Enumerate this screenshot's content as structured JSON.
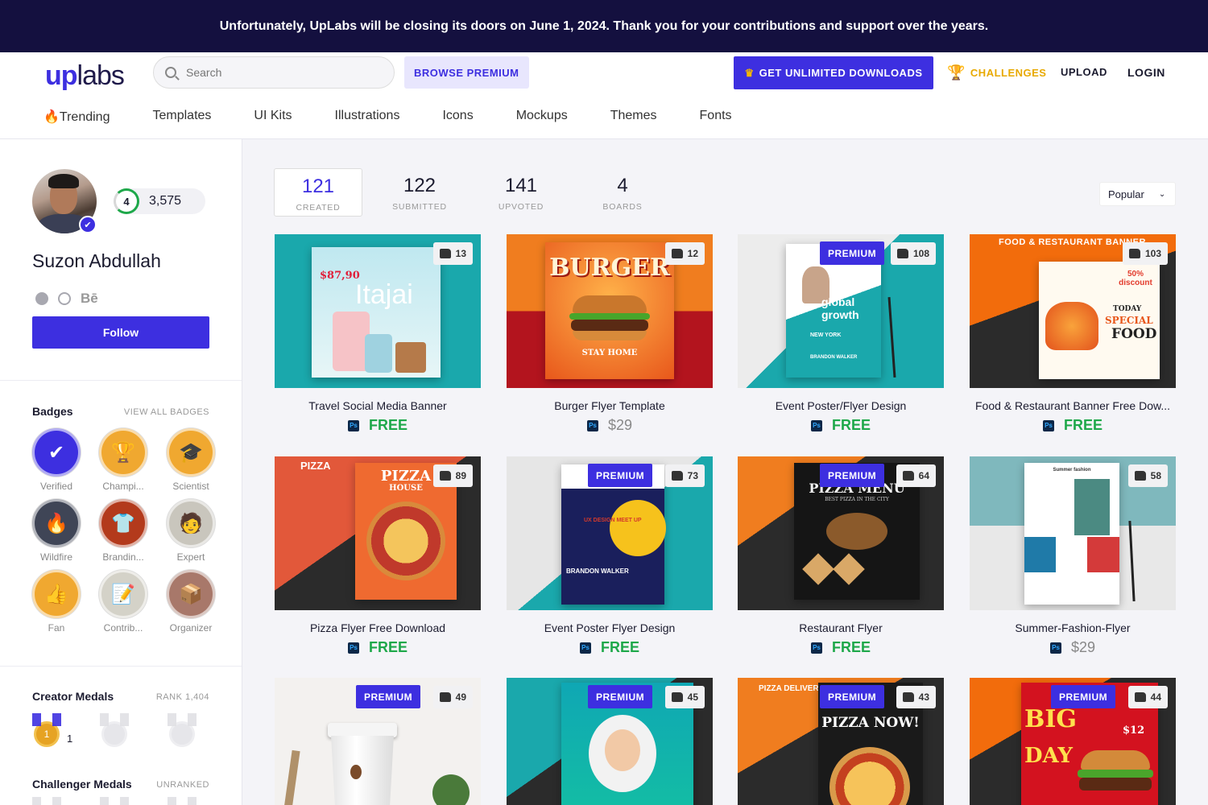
{
  "banner": {
    "text": "Unfortunately, UpLabs will be closing its doors on June 1, 2024. Thank you for your contributions and support over the years."
  },
  "header": {
    "logo_up": "up",
    "logo_labs": "labs",
    "search_placeholder": "Search",
    "browse_premium": "BROWSE PREMIUM",
    "get_unlimited": "GET UNLIMITED DOWNLOADS",
    "challenges": "CHALLENGES",
    "upload": "UPLOAD",
    "login": "LOGIN"
  },
  "nav": {
    "items": [
      "🔥Trending",
      "Templates",
      "UI Kits",
      "Illustrations",
      "Icons",
      "Mockups",
      "Themes",
      "Fonts"
    ]
  },
  "profile": {
    "name": "Suzon Abdullah",
    "level": "4",
    "points": "3,575",
    "behance": "Bē",
    "follow": "Follow"
  },
  "badges": {
    "title": "Badges",
    "view_all": "VIEW ALL BADGES",
    "items": [
      {
        "label": "Verified",
        "icon": "checkmark-icon",
        "color": "#3d2fe0",
        "glyph": "✔"
      },
      {
        "label": "Champi...",
        "icon": "trophy-icon",
        "color": "#f0a830",
        "glyph": "🏆"
      },
      {
        "label": "Scientist",
        "icon": "graduation-cap-icon",
        "color": "#f0a830",
        "glyph": "🎓"
      },
      {
        "label": "Wildfire",
        "icon": "fire-icon",
        "color": "#3f4556",
        "glyph": "🔥"
      },
      {
        "label": "Brandin...",
        "icon": "tshirt-icon",
        "color": "#b33a1c",
        "glyph": "👕"
      },
      {
        "label": "Expert",
        "icon": "expert-icon",
        "color": "#c9c6bd",
        "glyph": "🧑"
      },
      {
        "label": "Fan",
        "icon": "thumbs-up-icon",
        "color": "#f0a830",
        "glyph": "👍"
      },
      {
        "label": "Contrib...",
        "icon": "notepad-icon",
        "color": "#d4d2c8",
        "glyph": "📝"
      },
      {
        "label": "Organizer",
        "icon": "box-icon",
        "color": "#a8786a",
        "glyph": "📦"
      }
    ]
  },
  "creator_medals": {
    "title": "Creator Medals",
    "rank": "RANK 1,404",
    "count": "1",
    "first": "1"
  },
  "challenger_medals": {
    "title": "Challenger Medals",
    "rank": "UNRANKED"
  },
  "stats": [
    {
      "num": "121",
      "label": "CREATED"
    },
    {
      "num": "122",
      "label": "SUBMITTED"
    },
    {
      "num": "141",
      "label": "UPVOTED"
    },
    {
      "num": "4",
      "label": "BOARDS"
    }
  ],
  "sort": {
    "value": "Popular"
  },
  "premium_label": "PREMIUM",
  "ps_label": "Ps",
  "cards": [
    {
      "title": "Travel Social Media Banner",
      "price": "FREE",
      "likes": "13"
    },
    {
      "title": "Burger Flyer Template",
      "price": "$29",
      "likes": "12"
    },
    {
      "title": "Event Poster/Flyer Design",
      "price": "FREE",
      "likes": "108"
    },
    {
      "title": "Food & Restaurant Banner Free Dow...",
      "price": "FREE",
      "likes": "103"
    },
    {
      "title": "Pizza Flyer Free Download",
      "price": "FREE",
      "likes": "89"
    },
    {
      "title": "Event Poster Flyer Design",
      "price": "FREE",
      "likes": "73"
    },
    {
      "title": "Restaurant Flyer",
      "price": "FREE",
      "likes": "64"
    },
    {
      "title": "Summer-Fashion-Flyer",
      "price": "$29",
      "likes": "58"
    },
    {
      "likes": "49"
    },
    {
      "likes": "45"
    },
    {
      "likes": "43"
    },
    {
      "likes": "44"
    }
  ],
  "thumb_text": {
    "c1_price": "$87,90",
    "c1_word": "Itajai",
    "c2_word": "BURGER",
    "c2_tag": "STAY HOME",
    "c3_word": "global growth",
    "c3_city": "NEW YORK",
    "c3_name": "BRANDON WALKER",
    "c4_head": "FOOD & RESTAURANT BANNER",
    "c4_today": "TODAY",
    "c4_special": "SPECIAL",
    "c4_food": "FOOD",
    "c4_off": "50% discount",
    "c5_label": "PIZZA",
    "c5_word": "PIZZA",
    "c5_house": "HOUSE",
    "c6_ux": "UX DESIGN MEET UP",
    "c6_name": "BRANDON WALKER",
    "c7_menu": "PIZZA MENU",
    "c7_sub": "BEST PIZZA IN THE CITY",
    "c8_brand": "Summer fashion",
    "c11_label": "PIZZA DELIVERY",
    "c11_word": "PIZZA NOW!",
    "c12_big": "BIG",
    "c12_day": "DAY",
    "c12_price": "$12"
  }
}
